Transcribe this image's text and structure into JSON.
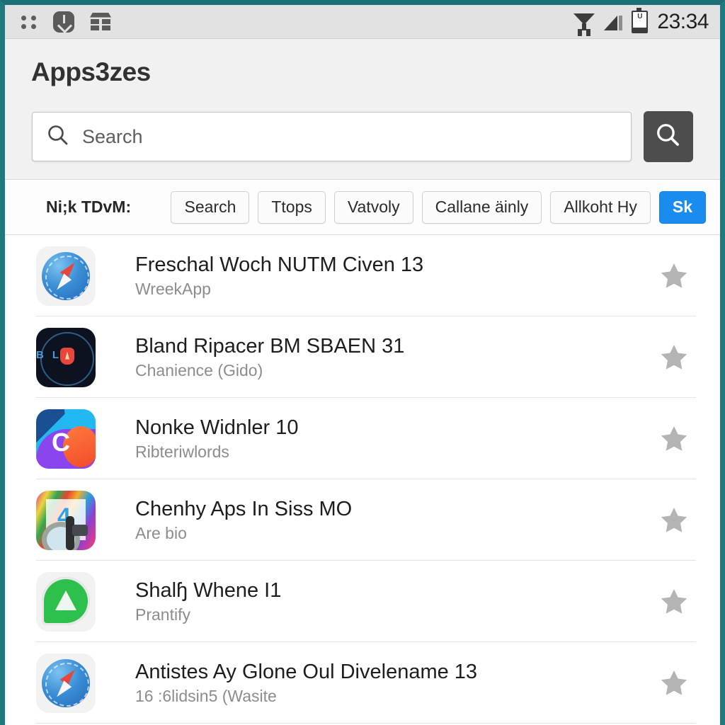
{
  "theme": {
    "frame_border": "#1f7a80",
    "statusbar_bg": "#e2e2e2",
    "header_bg": "#f1f1f1",
    "accent_chip": "#1a8cf0",
    "search_button_bg": "#4d4d4d",
    "star_color": "#b4b4b4"
  },
  "statusbar": {
    "left_icons": [
      "grid-dots-icon",
      "download-icon",
      "package-icon"
    ],
    "right_icons": [
      "wifi-icon",
      "signal-icon",
      "battery-icon"
    ],
    "battery_label": "U",
    "time": "23:34"
  },
  "header": {
    "title": "Apps3zes"
  },
  "search": {
    "placeholder": "Search",
    "value": "",
    "button_icon": "search-icon"
  },
  "filters": {
    "label": "Ni;k TDvM:",
    "chips": [
      {
        "label": "Search",
        "primary": false
      },
      {
        "label": "Ttops",
        "primary": false
      },
      {
        "label": "Vatvoly",
        "primary": false
      },
      {
        "label": "Callane äinly",
        "primary": false
      },
      {
        "label": "Allkoht Hy",
        "primary": false
      },
      {
        "label": "Sk",
        "primary": true
      }
    ]
  },
  "list": {
    "items": [
      {
        "icon": "safari-compass-icon",
        "title": "Freschal Woch NUTM Civen 13",
        "subtitle": "WreekApp",
        "star": "star-icon"
      },
      {
        "icon": "brave-shield-icon",
        "title": "Bland Ripacer BM SBAEN 31",
        "subtitle": "Chanience (Gido)",
        "star": "star-icon"
      },
      {
        "icon": "copilot-icon",
        "title": "Nonke Widnler 10",
        "subtitle": "Ribteriwlords",
        "star": "star-icon"
      },
      {
        "icon": "rainbow-photo-icon",
        "title": "Chenhy Aps In Siss MO",
        "subtitle": "Are bio",
        "star": "star-icon"
      },
      {
        "icon": "green-chat-icon",
        "title": "Shalɧ Whene I1",
        "subtitle": "Prantify",
        "star": "star-icon"
      },
      {
        "icon": "safari-compass-icon",
        "title": "Antistes Ay Glone Oul Divelename 13",
        "subtitle": "16 :6lidsin5 (Wasite",
        "star": "star-icon"
      }
    ]
  }
}
